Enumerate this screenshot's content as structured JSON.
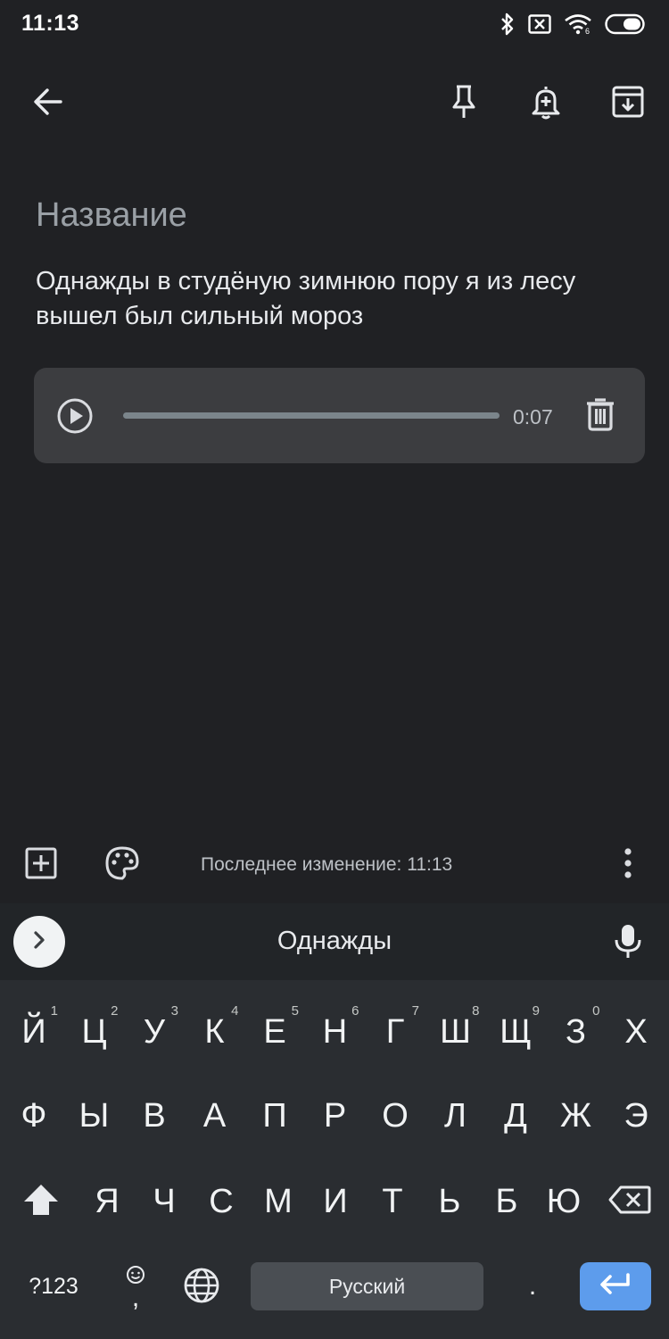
{
  "status_bar": {
    "time": "11:13",
    "icons": [
      "bluetooth-icon",
      "sim-error-icon",
      "wifi-icon",
      "battery-icon"
    ]
  },
  "top_bar": {
    "icons": [
      "back-arrow-icon",
      "pin-icon",
      "reminder-bell-icon",
      "archive-icon"
    ]
  },
  "note": {
    "title_placeholder": "Название",
    "body": "Однажды в студёную зимнюю пору я из лесу вышел был сильный мороз"
  },
  "audio": {
    "duration": "0:07",
    "progress": 0.0
  },
  "bottom_toolbar": {
    "edited_text": "Последнее изменение: 11:13"
  },
  "keyboard": {
    "suggestion": "Однажды",
    "row1": [
      {
        "key": "Й",
        "hint": "1"
      },
      {
        "key": "Ц",
        "hint": "2"
      },
      {
        "key": "У",
        "hint": "3"
      },
      {
        "key": "К",
        "hint": "4"
      },
      {
        "key": "Е",
        "hint": "5"
      },
      {
        "key": "Н",
        "hint": "6"
      },
      {
        "key": "Г",
        "hint": "7"
      },
      {
        "key": "Ш",
        "hint": "8"
      },
      {
        "key": "Щ",
        "hint": "9"
      },
      {
        "key": "З",
        "hint": "0"
      },
      {
        "key": "Х",
        "hint": ""
      }
    ],
    "row2": [
      "Ф",
      "Ы",
      "В",
      "А",
      "П",
      "Р",
      "О",
      "Л",
      "Д",
      "Ж",
      "Э"
    ],
    "row3": [
      "Я",
      "Ч",
      "С",
      "М",
      "И",
      "Т",
      "Ь",
      "Б",
      "Ю"
    ],
    "symbols_label": "?123",
    "emoji_comma_label": ",",
    "space_label": "Русский",
    "period_label": "."
  },
  "colors": {
    "background": "#202124",
    "keyboard": "#2a2d31",
    "accent": "#5d9cec"
  }
}
